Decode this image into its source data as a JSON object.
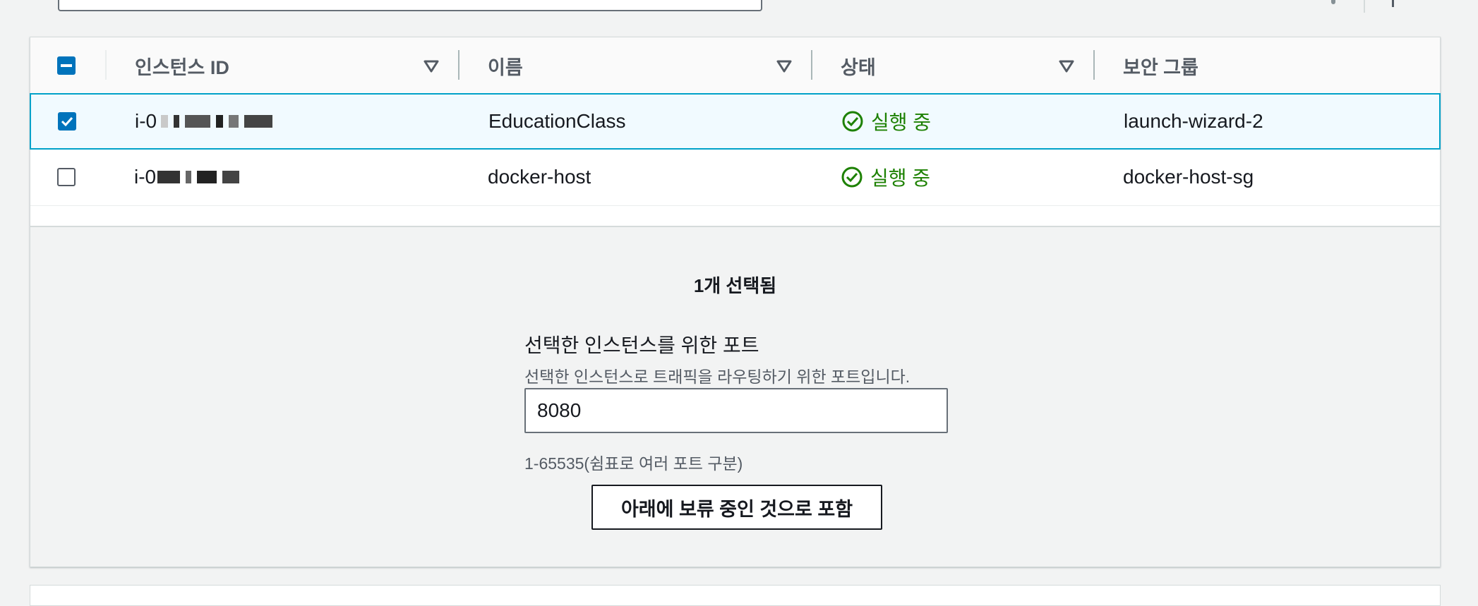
{
  "table": {
    "columns": [
      {
        "label": "인스턴스 ID"
      },
      {
        "label": "이름"
      },
      {
        "label": "상태"
      },
      {
        "label": "보안 그룹"
      }
    ],
    "rows": [
      {
        "instance_id": "i-0",
        "name": "EducationClass",
        "status": "실행 중",
        "security_group": "launch-wizard-2",
        "checked": true
      },
      {
        "instance_id": "i-0",
        "name": "docker-host",
        "status": "실행 중",
        "security_group": "docker-host-sg",
        "checked": false
      }
    ]
  },
  "panel": {
    "selected_count": "1개 선택됨",
    "port_label": "선택한 인스턴스를 위한 포트",
    "port_description": "선택한 인스턴스로 트래픽을 라우팅하기 위한 포트입니다.",
    "port_value": "8080",
    "port_hint": "1-65535(쉼표로 여러 포트 구분)",
    "include_button": "아래에 보류 중인 것으로 포함"
  },
  "colors": {
    "accent": "#0073bb",
    "selected_row_border": "#00a1c9",
    "status_running": "#1d8102"
  },
  "icons": [
    "sort-down-icon",
    "check-circle-icon",
    "checkbox-checked-icon",
    "checkbox-indeterminate-icon"
  ]
}
